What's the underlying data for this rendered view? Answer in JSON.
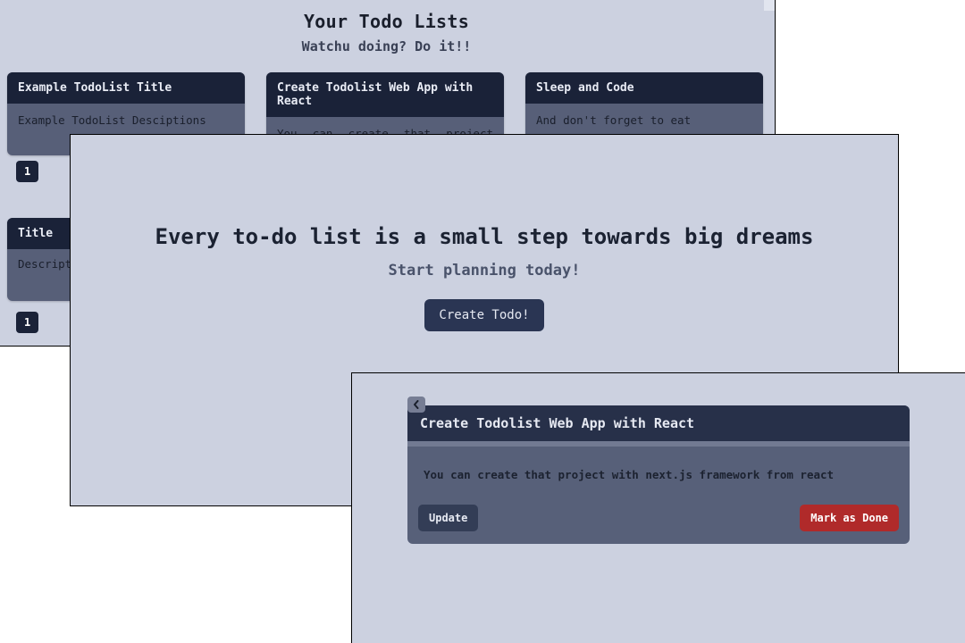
{
  "win1": {
    "title": "Your Todo Lists",
    "subtitle": "Watchu doing? Do it!!",
    "cards": [
      {
        "title": "Example TodoList Title",
        "desc": "Example TodoList Desciptions",
        "badge": "1"
      },
      {
        "title": "Create Todolist Web App with React",
        "desc": "You can create that project with next.js framework from react"
      },
      {
        "title": "Sleep and Code",
        "desc": "And don't forget to eat"
      }
    ],
    "row2": {
      "title": "Title",
      "desc": "Descript",
      "badge": "1"
    }
  },
  "win2": {
    "heading": "Every to-do list is a small step towards big dreams",
    "sub": "Start planning today!",
    "cta": "Create Todo!"
  },
  "win3": {
    "title": "Create Todolist Web App with React",
    "body": "You can create that project with next.js framework from react",
    "update": "Update",
    "done": "Mark as Done"
  }
}
